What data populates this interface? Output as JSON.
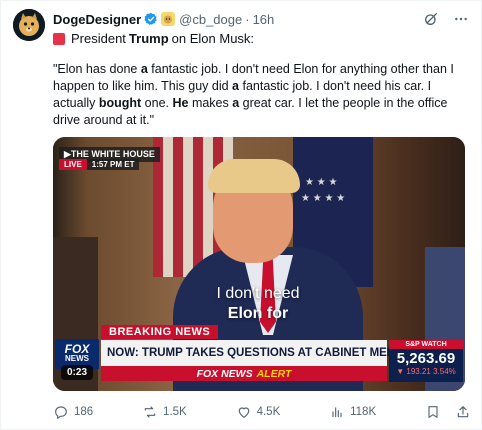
{
  "author": {
    "display_name": "DogeDesigner",
    "handle": "@cb_doge",
    "separator": "·",
    "time": "16h"
  },
  "subtitle": {
    "prefix": "President",
    "bold": "Trump",
    "suffix": "on Elon Musk:"
  },
  "quote": {
    "p1": "\"Elon has done ",
    "b1": "a",
    "p2": " fantastic job. I don't need Elon for anything other than I happen to like him. This guy did ",
    "b2": "a",
    "p3": " fantastic job. I don't need his car. I actually ",
    "b3": "bought",
    "p4": " one. ",
    "b4": "He",
    "p5": " makes ",
    "b5": "a",
    "p6": " great car. I let the people in the office drive around at it.\""
  },
  "video": {
    "network_bug": "▶THE WHITE HOUSE",
    "live": "LIVE",
    "clock": "1:57 PM ET",
    "caption_line1": "I don't need",
    "caption_line2": "Elon for",
    "breaking": "BREAKING NEWS",
    "headline": "NOW: TRUMP TAKES QUESTIONS AT CABINET MEETING",
    "alert_prefix": "FOX NEWS",
    "alert_word": "ALERT",
    "logo_line1": "FOX",
    "logo_line2": "NEWS",
    "sp_label": "S&P WATCH",
    "sp_value": "5,263.69",
    "sp_change": "▼ 193.21  3.54%",
    "duration": "0:23"
  },
  "actions": {
    "replies": "186",
    "reposts": "1.5K",
    "likes": "4.5K",
    "views": "118K"
  },
  "colors": {
    "accent": "#1d9bf0",
    "muted": "#536471",
    "fox_red": "#c8102e",
    "fox_blue": "#0d1f4c"
  }
}
